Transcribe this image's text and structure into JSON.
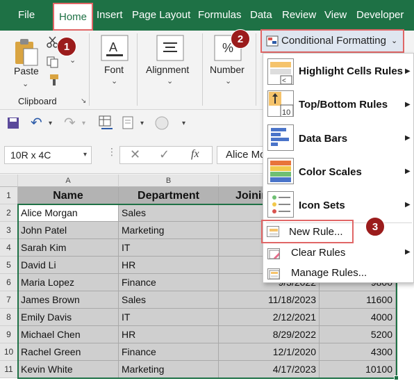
{
  "menubar": {
    "tabs": [
      "File",
      "Home",
      "Insert",
      "Page Layout",
      "Formulas",
      "Data",
      "Review",
      "View",
      "Developer"
    ]
  },
  "ribbon": {
    "paste_label": "Paste",
    "clipboard_label": "Clipboard",
    "font_label": "Font",
    "alignment_label": "Alignment",
    "number_label": "Number",
    "conditional_formatting_label": "Conditional Formatting"
  },
  "badges": [
    "1",
    "2",
    "3"
  ],
  "formula_bar": {
    "name_box": "10R x 4C",
    "value": "Alice Morgan",
    "fx": "fx"
  },
  "columns": [
    "A",
    "B"
  ],
  "rows": [
    "1",
    "2",
    "3",
    "4",
    "5",
    "6",
    "7",
    "8",
    "9",
    "10",
    "11"
  ],
  "table": {
    "headers": [
      "Name",
      "Department",
      "Joining Date",
      ""
    ],
    "data": [
      [
        "Alice Morgan",
        "Sales",
        "",
        ""
      ],
      [
        "John Patel",
        "Marketing",
        "",
        ""
      ],
      [
        "Sarah Kim",
        "IT",
        "",
        ""
      ],
      [
        "David Li",
        "HR",
        "",
        ""
      ],
      [
        "Maria Lopez",
        "Finance",
        "9/3/2022",
        "9800"
      ],
      [
        "James Brown",
        "Sales",
        "11/18/2023",
        "11600"
      ],
      [
        "Emily Davis",
        "IT",
        "2/12/2021",
        "4000"
      ],
      [
        "Michael Chen",
        "HR",
        "8/29/2022",
        "5200"
      ],
      [
        "Rachel Green",
        "Finance",
        "12/1/2020",
        "4300"
      ],
      [
        "Kevin White",
        "Marketing",
        "4/17/2023",
        "10100"
      ]
    ]
  },
  "dropdown": {
    "items": [
      {
        "label": "Highlight Cells Rules",
        "hotkey": "H",
        "rest": "ighlight Cells Rules"
      },
      {
        "label": "Top/Bottom Rules",
        "hotkey": "T",
        "rest": "op/Bottom Rules"
      },
      {
        "label": "Data Bars",
        "hotkey": "D",
        "rest": "ata Bars"
      },
      {
        "label": "Color Scales",
        "hotkey": "S",
        "rest": "Color Scales"
      },
      {
        "label": "Icon Sets",
        "hotkey": "I",
        "rest": "con Sets"
      }
    ],
    "new_rule": "New Rule...",
    "clear_rules": "Clear Rules",
    "manage_rules": "Manage Rules..."
  },
  "colors": {
    "excel_green": "#1e7145",
    "highlight_red": "#e06666",
    "badge_red": "#9b1c1c"
  }
}
